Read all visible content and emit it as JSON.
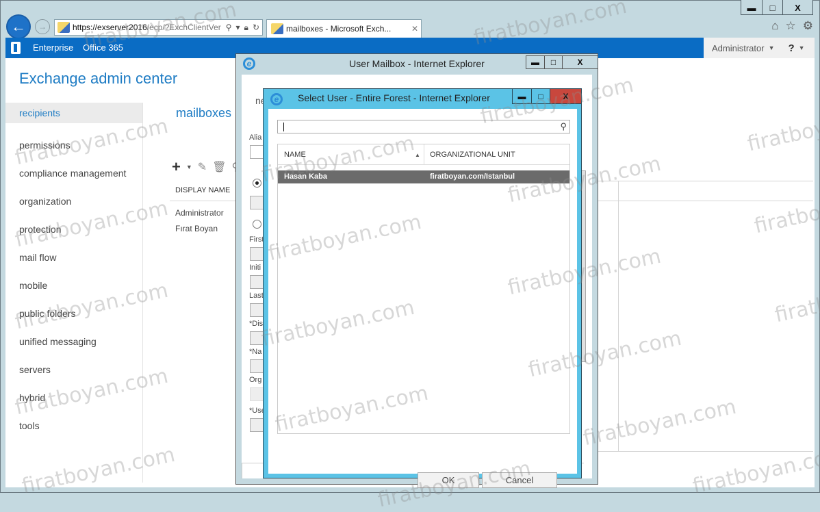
{
  "browser": {
    "address_host": "https://exserver2016",
    "address_path": "/ecp/?ExchClientVer",
    "tab_label": "mailboxes - Microsoft Exch...",
    "window_controls": {
      "minimize": "▬",
      "maximize": "□",
      "close": "X"
    }
  },
  "suite": {
    "links": [
      "Enterprise",
      "Office 365"
    ],
    "user": "Administrator",
    "help": "?"
  },
  "eac": {
    "title": "Exchange admin center",
    "nav": [
      {
        "label": "recipients",
        "active": true
      },
      {
        "label": "permissions"
      },
      {
        "label": "compliance management"
      },
      {
        "label": "organization"
      },
      {
        "label": "protection"
      },
      {
        "label": "mail flow"
      },
      {
        "label": "mobile"
      },
      {
        "label": "public folders"
      },
      {
        "label": "unified messaging"
      },
      {
        "label": "servers"
      },
      {
        "label": "hybrid"
      },
      {
        "label": "tools"
      }
    ],
    "section_title": "mailboxes",
    "grid": {
      "column": "DISPLAY NAME",
      "rows": [
        "Administrator",
        "Fırat Boyan"
      ]
    }
  },
  "user_mailbox": {
    "title": "User Mailbox - Internet Explorer",
    "heading_partial": "ne",
    "labels": [
      "Alia",
      "First",
      "Initi",
      "Last",
      "*Dis",
      "*Na",
      "Org",
      "*Use"
    ]
  },
  "select_user": {
    "title": "Select User - Entire Forest - Internet Explorer",
    "search_value": "",
    "columns": [
      "NAME",
      "ORGANIZATIONAL UNIT"
    ],
    "rows": [
      {
        "name": "Hasan Kaba",
        "ou": "firatboyan.com/Istanbul",
        "selected": true
      }
    ],
    "ok_label": "OK",
    "cancel_label": "Cancel"
  },
  "watermark": "firatboyan.com"
}
